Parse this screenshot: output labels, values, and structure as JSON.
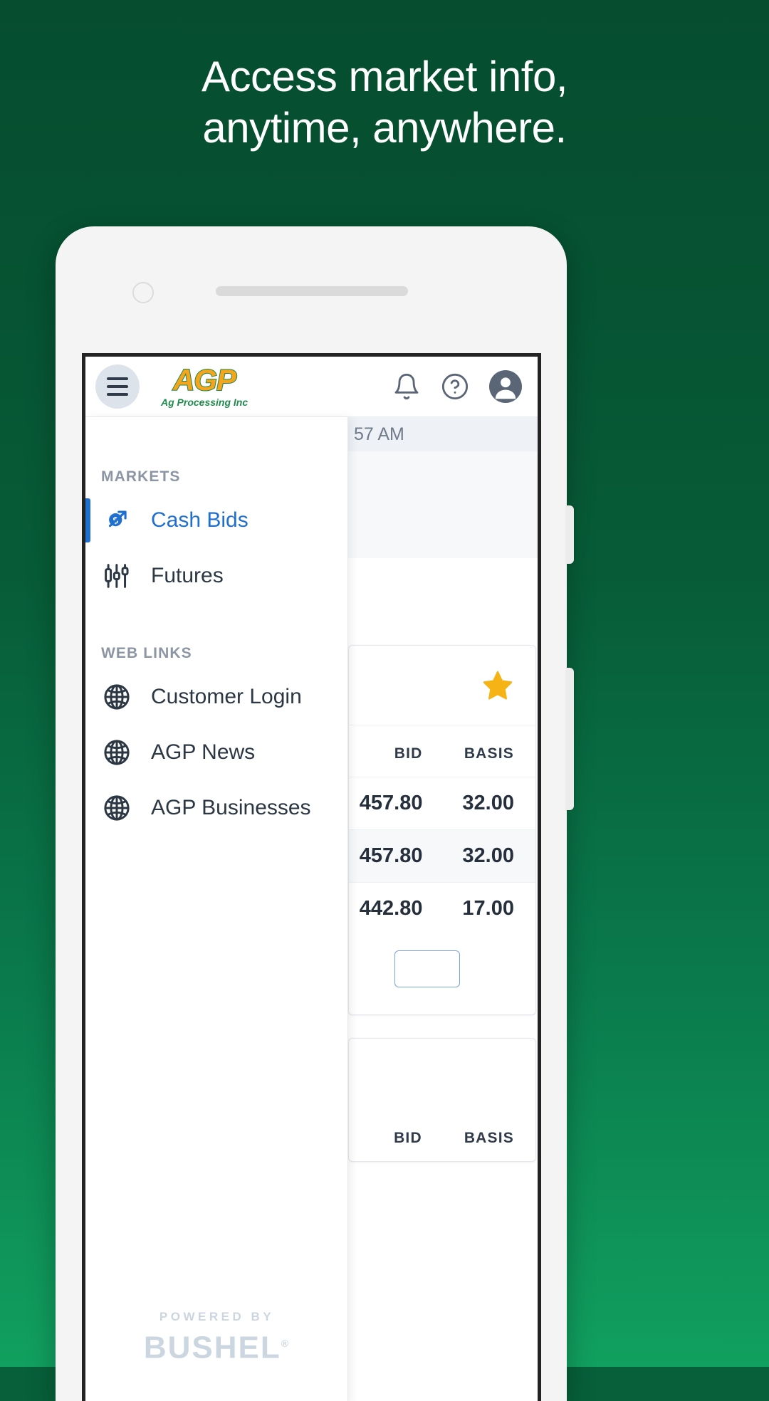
{
  "promo": {
    "headline_line1": "Access market info,",
    "headline_line2": "anytime, anywhere.",
    "background_color": "#07603a",
    "text_color": "#ffffff"
  },
  "appbar": {
    "menu_icon": "hamburger-icon",
    "logo_mark": "AGP",
    "logo_subtitle": "Ag Processing Inc",
    "logo_color": "#f4a51c",
    "logo_outline_color": "#1f8a4c",
    "notifications_icon": "bell-icon",
    "help_icon": "question-circle-icon",
    "account_icon": "user-avatar-icon"
  },
  "drawer": {
    "sections": [
      {
        "label": "MARKETS",
        "items": [
          {
            "label": "Cash Bids",
            "icon": "dollar-trend-icon",
            "active": true
          },
          {
            "label": "Futures",
            "icon": "candlestick-icon",
            "active": false
          }
        ]
      },
      {
        "label": "WEB LINKS",
        "items": [
          {
            "label": "Customer Login",
            "icon": "globe-icon",
            "active": false
          },
          {
            "label": "AGP News",
            "icon": "globe-icon",
            "active": false
          },
          {
            "label": "AGP Businesses",
            "icon": "globe-icon",
            "active": false
          }
        ]
      }
    ],
    "active_color": "#1f6fd0",
    "footer": {
      "powered_by": "POWERED BY",
      "brand": "BUSHEL",
      "trademark": "®"
    }
  },
  "content": {
    "timestamp": "57 AM",
    "favorite_icon": "star-icon",
    "favorite_color": "#f5b316",
    "cards": [
      {
        "columns": [
          "BID",
          "BASIS"
        ],
        "rows": [
          {
            "bid": "457.80",
            "basis": "32.00",
            "highlighted": false
          },
          {
            "bid": "457.80",
            "basis": "32.00",
            "highlighted": true
          },
          {
            "bid": "442.80",
            "basis": "17.00",
            "highlighted": false
          }
        ]
      },
      {
        "columns": [
          "BID",
          "BASIS"
        ],
        "rows": []
      }
    ]
  }
}
